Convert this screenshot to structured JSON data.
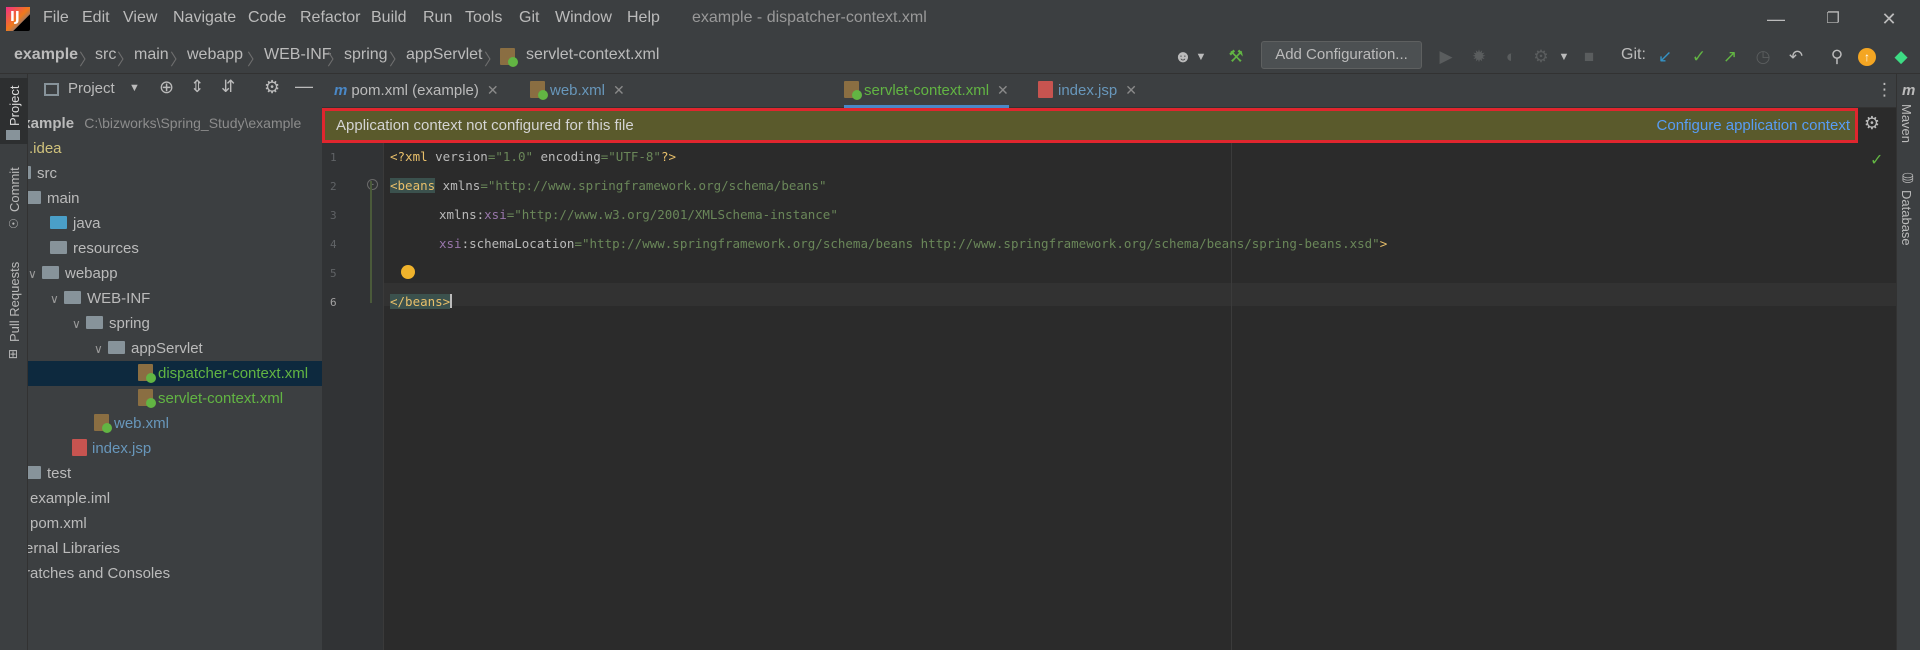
{
  "menubar": {
    "items": [
      "File",
      "Edit",
      "View",
      "Navigate",
      "Code",
      "Refactor",
      "Build",
      "Run",
      "Tools",
      "Git",
      "Window",
      "Help"
    ],
    "window_title": "example - dispatcher-context.xml"
  },
  "navbar": {
    "breadcrumbs": [
      "example",
      "src",
      "main",
      "webapp",
      "WEB-INF",
      "spring",
      "appServlet",
      "servlet-context.xml"
    ],
    "add_configuration": "Add Configuration...",
    "git_label": "Git:"
  },
  "left_stripe": {
    "project": "Project",
    "commit": "Commit",
    "pull_requests": "Pull Requests"
  },
  "right_stripe": {
    "maven": "Maven",
    "database": "Database"
  },
  "project_panel": {
    "title": "Project",
    "tree": [
      {
        "label": "example",
        "path": "C:\\bizworks\\Spring_Study\\example",
        "type": "root"
      },
      {
        "label": ".idea",
        "type": "folder"
      },
      {
        "label": "src",
        "type": "folder"
      },
      {
        "label": "main",
        "type": "folder"
      },
      {
        "label": "java",
        "type": "folder"
      },
      {
        "label": "resources",
        "type": "folder"
      },
      {
        "label": "webapp",
        "type": "folder"
      },
      {
        "label": "WEB-INF",
        "type": "folder"
      },
      {
        "label": "spring",
        "type": "folder"
      },
      {
        "label": "appServlet",
        "type": "folder"
      },
      {
        "label": "dispatcher-context.xml",
        "type": "xml"
      },
      {
        "label": "servlet-context.xml",
        "type": "xml"
      },
      {
        "label": "web.xml",
        "type": "xml"
      },
      {
        "label": "index.jsp",
        "type": "jsp"
      },
      {
        "label": "test",
        "type": "folder"
      },
      {
        "label": "example.iml",
        "type": "file"
      },
      {
        "label": "pom.xml",
        "type": "file"
      },
      {
        "label": "ernal Libraries",
        "type": "lib"
      },
      {
        "label": "ratches and Consoles",
        "type": "lib"
      }
    ]
  },
  "tabs": [
    {
      "label": "pom.xml (example)"
    },
    {
      "label": "web.xml"
    },
    {
      "label": "servlet-context.xml"
    },
    {
      "label": "index.jsp"
    }
  ],
  "banner": {
    "message": "Application context not configured for this file",
    "action": "Configure application context"
  },
  "editor": {
    "line_numbers": [
      "1",
      "2",
      "3",
      "4",
      "5",
      "6"
    ],
    "line1": {
      "pi_open": "<?xml ",
      "a1": "version",
      "v1": "=\"1.0\" ",
      "a2": "encoding",
      "v2": "=\"UTF-8\"",
      "pi_close": "?>"
    },
    "line2": {
      "tag": "<beans",
      "attr": " xmlns",
      "val": "=\"http://www.springframework.org/schema/beans\""
    },
    "line3": {
      "attr": "xmlns:",
      "ns": "xsi",
      "val": "=\"http://www.w3.org/2001/XMLSchema-instance\""
    },
    "line4": {
      "ns": "xsi",
      "attr": ":schemaLocation",
      "val": "=\"http://www.springframework.org/schema/beans http://www.springframework.org/schema/beans/spring-beans.xsd\"",
      "tag_close": ">"
    },
    "line6": {
      "tag": "</beans>"
    }
  }
}
